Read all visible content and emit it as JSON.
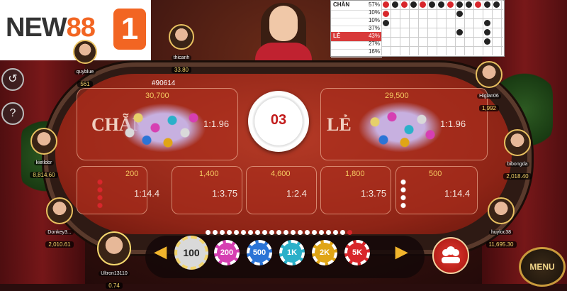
{
  "brand": {
    "logo_text_a": "NEW",
    "logo_text_b": "88",
    "logo_mark": "1"
  },
  "round": {
    "id": "#90614",
    "number": "03"
  },
  "stats": {
    "rows": [
      {
        "label": "CHẴN",
        "value": "57%"
      },
      {
        "label": "",
        "value": "10%"
      },
      {
        "label": "",
        "value": "10%"
      },
      {
        "label": "",
        "value": "37%"
      },
      {
        "label": "LẺ",
        "value": "43%"
      },
      {
        "label": "",
        "value": "27%"
      },
      {
        "label": "",
        "value": "16%"
      }
    ]
  },
  "bets": {
    "chan": {
      "label": "CHẴN",
      "amount": "30,700",
      "odds": "1:1.96"
    },
    "le": {
      "label": "LẺ",
      "amount": "29,500",
      "odds": "1:1.96"
    },
    "side": [
      {
        "amount": "200",
        "odds": "1:14.4"
      },
      {
        "amount": "1,400",
        "odds": "1:3.75"
      },
      {
        "amount": "4,600",
        "odds": "1:2.4"
      },
      {
        "amount": "1,800",
        "odds": "1:3.75"
      },
      {
        "amount": "500",
        "odds": "1:14.4"
      }
    ]
  },
  "players": [
    {
      "name": "quyblue",
      "balance": "561"
    },
    {
      "name": "thicanh",
      "balance": "33.80"
    },
    {
      "name": "kietlobr",
      "balance": "8,814.60"
    },
    {
      "name": "Donkey3...",
      "balance": "2,010.61"
    },
    {
      "name": "Higlan06",
      "balance": "1,992"
    },
    {
      "name": "bibongda",
      "balance": "2,018.40"
    },
    {
      "name": "huyloc38",
      "balance": "11,695.30"
    },
    {
      "name": "Ultron13110",
      "balance": "0.74"
    }
  ],
  "chips": [
    {
      "label": "100",
      "color": "#d9d9d9"
    },
    {
      "label": "200",
      "color": "#d63fb2"
    },
    {
      "label": "500",
      "color": "#2b74d6"
    },
    {
      "label": "1K",
      "color": "#2bb0c9"
    },
    {
      "label": "2K",
      "color": "#e0a516"
    },
    {
      "label": "5K",
      "color": "#d8262b"
    }
  ],
  "controls": {
    "menu_label": "MENU",
    "history_icon": "history-icon",
    "help_label": "?"
  }
}
